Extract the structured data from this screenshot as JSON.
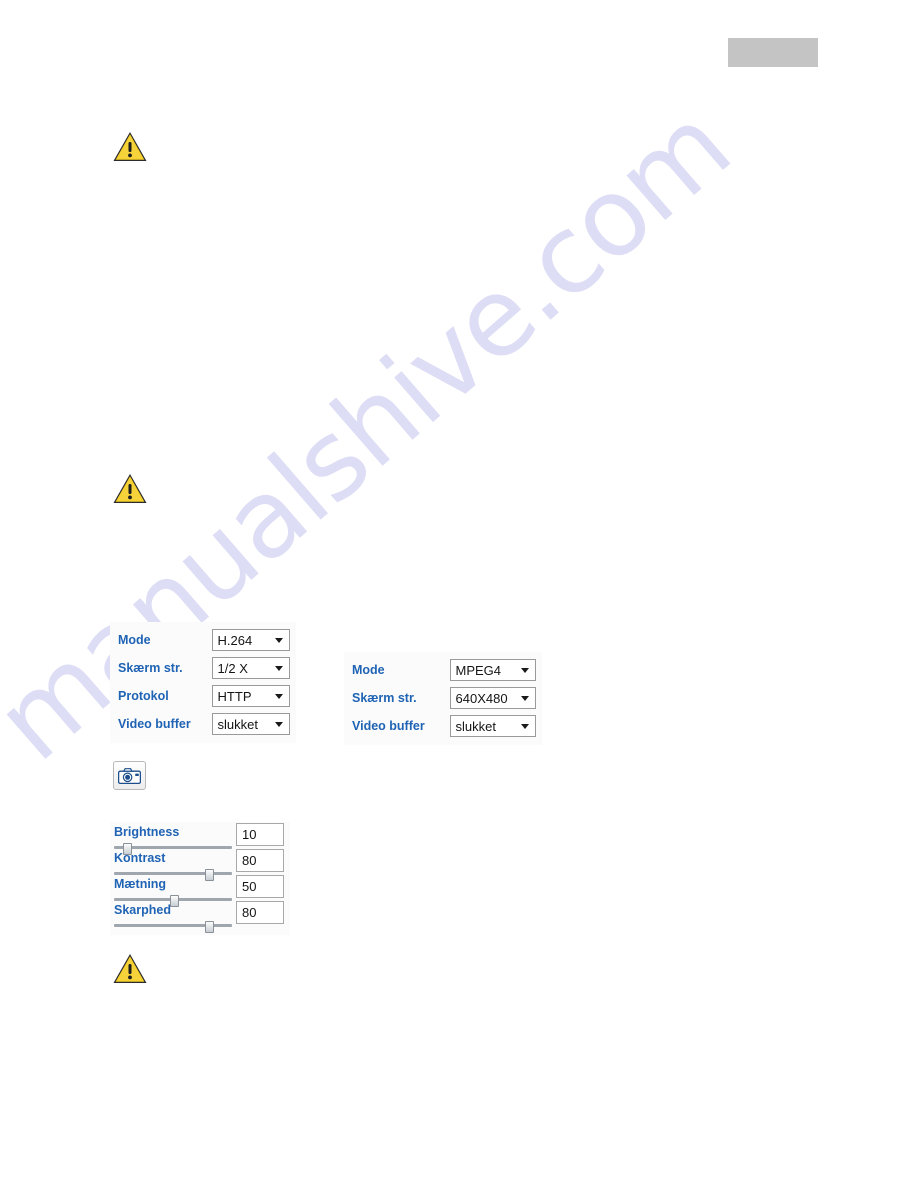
{
  "page": {
    "background_color": "#ffffff",
    "watermark_text": "manualshive.com",
    "watermark_color": "#c9c9f0"
  },
  "header": {
    "placeholder_block_color": "#c4c4c4"
  },
  "notes": [
    {
      "icon": "warning-triangle-icon"
    },
    {
      "icon": "warning-triangle-icon"
    },
    {
      "icon": "warning-triangle-icon"
    }
  ],
  "video_settings_left": {
    "label_color": "#1f63b4",
    "rows": [
      {
        "label": "Mode",
        "value": "H.264",
        "caret": "chevron-down-icon"
      },
      {
        "label": "Skærm str.",
        "value": "1/2 X",
        "caret": "chevron-down-icon"
      },
      {
        "label": "Protokol",
        "value": "HTTP",
        "caret": "chevron-down-icon"
      },
      {
        "label": "Video buffer",
        "value": "slukket",
        "caret": "chevron-down-icon"
      }
    ]
  },
  "video_settings_right": {
    "label_color": "#1f63b4",
    "rows": [
      {
        "label": "Mode",
        "value": "MPEG4",
        "caret": "chevron-down-icon"
      },
      {
        "label": "Skærm str.",
        "value": "640X480",
        "caret": "chevron-down-icon"
      },
      {
        "label": "Video buffer",
        "value": "slukket",
        "caret": "chevron-down-icon"
      }
    ]
  },
  "snapshot_button": {
    "icon": "camera-icon"
  },
  "image_adjust": {
    "label_color": "#1f63b4",
    "rows": [
      {
        "label": "Brightness",
        "value": "10",
        "percent": 10
      },
      {
        "label": "Kontrast",
        "value": "80",
        "percent": 80
      },
      {
        "label": "Mætning",
        "value": "50",
        "percent": 50
      },
      {
        "label": "Skarphed",
        "value": "80",
        "percent": 80
      }
    ]
  }
}
